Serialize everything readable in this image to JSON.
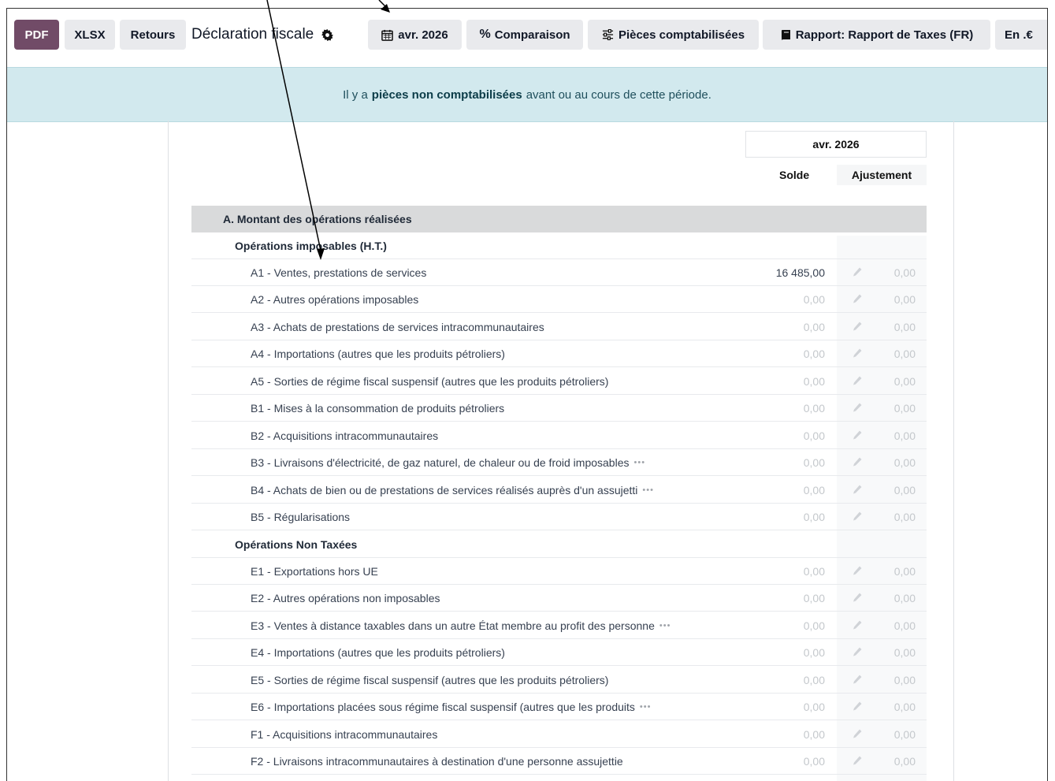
{
  "toolbar": {
    "pdf": "PDF",
    "xlsx": "XLSX",
    "retours": "Retours",
    "title": "Déclaration fiscale",
    "period": "avr. 2026",
    "comparison": "Comparaison",
    "entries": "Pièces comptabilisées",
    "report": "Rapport: Rapport de Taxes (FR)",
    "currency": "En .€"
  },
  "banner": {
    "before": "Il y a",
    "link": "pièces non comptabilisées",
    "after": "avant ou au cours de cette période."
  },
  "report": {
    "period_header": "avr. 2026",
    "col_balance": "Solde",
    "col_adjust": "Ajustement",
    "section": "A. Montant des opérations réalisées",
    "group1": "Opérations imposables (H.T.)",
    "group2": "Opérations Non Taxées",
    "lines": [
      {
        "label": "A1 - Ventes, prestations de services",
        "value": "16 485,00",
        "adj": "0,00"
      },
      {
        "label": "A2 - Autres opérations imposables",
        "value": "0,00",
        "adj": "0,00"
      },
      {
        "label": "A3 - Achats de prestations de services intracommunautaires",
        "value": "0,00",
        "adj": "0,00"
      },
      {
        "label": "A4 - Importations (autres que les produits pétroliers)",
        "value": "0,00",
        "adj": "0,00"
      },
      {
        "label": "A5 - Sorties de régime fiscal suspensif (autres que les produits pétroliers)",
        "value": "0,00",
        "adj": "0,00"
      },
      {
        "label": "B1 - Mises à la consommation de produits pétroliers",
        "value": "0,00",
        "adj": "0,00"
      },
      {
        "label": "B2 - Acquisitions intracommunautaires",
        "value": "0,00",
        "adj": "0,00"
      },
      {
        "label": "B3 - Livraisons d'électricité, de gaz naturel, de chaleur ou de froid imposables",
        "value": "0,00",
        "adj": "0,00"
      },
      {
        "label": "B4 - Achats de bien ou de prestations de services réalisés auprès d'un assujetti",
        "value": "0,00",
        "adj": "0,00"
      },
      {
        "label": "B5 - Régularisations",
        "value": "0,00",
        "adj": "0,00"
      },
      {
        "label": "E1 - Exportations hors UE",
        "value": "0,00",
        "adj": "0,00"
      },
      {
        "label": "E2 - Autres opérations non imposables",
        "value": "0,00",
        "adj": "0,00"
      },
      {
        "label": "E3 - Ventes à distance taxables dans un autre État membre au profit des personne",
        "value": "0,00",
        "adj": "0,00"
      },
      {
        "label": "E4 - Importations (autres que les produits pétroliers)",
        "value": "0,00",
        "adj": "0,00"
      },
      {
        "label": "E5 - Sorties de régime fiscal suspensif (autres que les produits pétroliers)",
        "value": "0,00",
        "adj": "0,00"
      },
      {
        "label": "E6 - Importations placées sous régime fiscal suspensif (autres que les produits",
        "value": "0,00",
        "adj": "0,00"
      },
      {
        "label": "F1 - Acquisitions intracommunautaires",
        "value": "0,00",
        "adj": "0,00"
      },
      {
        "label": "F2 - Livraisons intracommunautaires à destination d'une personne assujettie",
        "value": "0,00",
        "adj": "0,00"
      }
    ]
  }
}
